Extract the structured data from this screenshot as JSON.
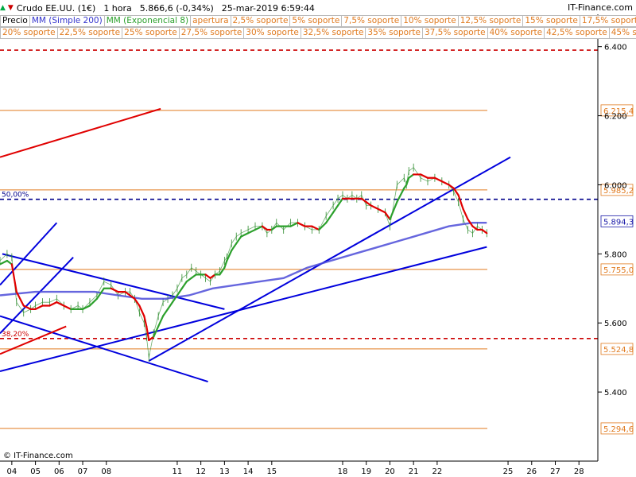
{
  "header": {
    "instrument": "Crudo EE.UU. (1€)",
    "timeframe": "1 hora",
    "quote": "5.866,6 (-0,34%)",
    "datetime": "25-mar-2019 6:59:44",
    "brand": "IT-Finance.com"
  },
  "legend": {
    "row1": [
      {
        "label": "Precio",
        "color": "#000000"
      },
      {
        "label": "MM (Simple 200)",
        "color": "#3333cc"
      },
      {
        "label": "MM (Exponencial 8)",
        "color": "#2ca02c"
      },
      {
        "label": "apertura",
        "color": "#e07a1f"
      },
      {
        "label": "2,5% soporte",
        "color": "#e07a1f"
      },
      {
        "label": "5% soporte",
        "color": "#e07a1f"
      },
      {
        "label": "7,5% soporte",
        "color": "#e07a1f"
      },
      {
        "label": "10% soporte",
        "color": "#e07a1f"
      },
      {
        "label": "12,5% soporte",
        "color": "#e07a1f"
      },
      {
        "label": "15% soporte",
        "color": "#e07a1f"
      },
      {
        "label": "17,5% soporte",
        "color": "#e07a1f"
      }
    ],
    "row2": [
      {
        "label": "20% soporte",
        "color": "#e07a1f"
      },
      {
        "label": "22,5% soporte",
        "color": "#e07a1f"
      },
      {
        "label": "25% soporte",
        "color": "#e07a1f"
      },
      {
        "label": "27,5% soporte",
        "color": "#e07a1f"
      },
      {
        "label": "30% soporte",
        "color": "#e07a1f"
      },
      {
        "label": "32,5% soporte",
        "color": "#e07a1f"
      },
      {
        "label": "35% soporte",
        "color": "#e07a1f"
      },
      {
        "label": "37,5% soporte",
        "color": "#e07a1f"
      },
      {
        "label": "40% soporte",
        "color": "#e07a1f"
      },
      {
        "label": "42,5% soporte",
        "color": "#e07a1f"
      },
      {
        "label": "45% s",
        "color": "#e07a1f"
      }
    ]
  },
  "footer": {
    "copyright": "© IT-Finance.com"
  },
  "chart_data": {
    "type": "line",
    "title": "Crudo EE.UU. (1€)",
    "x_unit": "day of March 2019",
    "xlim": [
      3.5,
      28.8
    ],
    "ylim": [
      5.2,
      6.42
    ],
    "x_ticks": [
      4,
      5,
      6,
      7,
      8,
      11,
      12,
      13,
      14,
      15,
      18,
      19,
      20,
      21,
      22,
      25,
      26,
      27,
      28
    ],
    "x_tick_labels": [
      "04",
      "05",
      "06",
      "07",
      "08",
      "11",
      "12",
      "13",
      "14",
      "15",
      "18",
      "19",
      "20",
      "21",
      "22",
      "25",
      "26",
      "27",
      "28"
    ],
    "y_ticks": [
      5.4,
      5.6,
      5.8,
      6.0,
      6.2,
      6.4
    ],
    "y_tick_labels": [
      "5.400",
      "5.600",
      "5.800",
      "6.000",
      "6.200",
      "6.400"
    ],
    "grid": false,
    "legend_placement": "top",
    "price_series": {
      "name": "Precio",
      "x": [
        3.5,
        3.8,
        4.0,
        4.2,
        4.5,
        4.8,
        5.0,
        5.3,
        5.6,
        5.9,
        6.2,
        6.5,
        6.8,
        7.0,
        7.3,
        7.6,
        7.9,
        8.2,
        8.5,
        8.8,
        9.0,
        9.2,
        9.4,
        9.6,
        9.7,
        9.8,
        10.0,
        10.2,
        10.4,
        10.6,
        10.8,
        11.0,
        11.2,
        11.4,
        11.6,
        11.8,
        12.0,
        12.2,
        12.4,
        12.6,
        12.8,
        13.0,
        13.1,
        13.3,
        13.5,
        13.7,
        14.0,
        14.3,
        14.6,
        14.8,
        15.0,
        15.2,
        15.5,
        15.8,
        16.1,
        16.4,
        16.7,
        17.0,
        17.3,
        17.6,
        17.8,
        18.0,
        18.2,
        18.4,
        18.6,
        18.8,
        19.0,
        19.2,
        19.5,
        19.8,
        20.0,
        20.3,
        20.6,
        20.7,
        20.8,
        21.0,
        21.3,
        21.6,
        21.9,
        22.2,
        22.5,
        22.7,
        22.9,
        23.1,
        23.3,
        23.5,
        23.7,
        23.9,
        24.1
      ],
      "y": [
        5.78,
        5.8,
        5.79,
        5.66,
        5.63,
        5.64,
        5.65,
        5.66,
        5.66,
        5.67,
        5.65,
        5.64,
        5.65,
        5.64,
        5.66,
        5.68,
        5.72,
        5.71,
        5.68,
        5.69,
        5.69,
        5.67,
        5.63,
        5.6,
        5.56,
        5.5,
        5.57,
        5.62,
        5.66,
        5.67,
        5.68,
        5.7,
        5.73,
        5.74,
        5.76,
        5.75,
        5.74,
        5.73,
        5.72,
        5.74,
        5.75,
        5.78,
        5.79,
        5.83,
        5.85,
        5.86,
        5.87,
        5.88,
        5.88,
        5.86,
        5.87,
        5.89,
        5.87,
        5.89,
        5.89,
        5.88,
        5.87,
        5.87,
        5.91,
        5.94,
        5.96,
        5.97,
        5.96,
        5.97,
        5.96,
        5.97,
        5.94,
        5.94,
        5.93,
        5.92,
        5.88,
        6.0,
        6.02,
        6.0,
        6.04,
        6.05,
        6.02,
        6.01,
        6.02,
        6.01,
        6.0,
        5.98,
        5.95,
        5.9,
        5.87,
        5.86,
        5.88,
        5.87,
        5.86
      ]
    },
    "ema8_series": {
      "name": "MM (Exponencial 8)",
      "x": [
        3.5,
        3.8,
        4.0,
        4.2,
        4.5,
        4.8,
        5.0,
        5.3,
        5.6,
        5.9,
        6.2,
        6.5,
        6.8,
        7.0,
        7.3,
        7.6,
        7.9,
        8.2,
        8.5,
        8.8,
        9.0,
        9.2,
        9.4,
        9.6,
        9.7,
        9.8,
        10.0,
        10.2,
        10.4,
        10.6,
        10.8,
        11.0,
        11.2,
        11.4,
        11.6,
        11.8,
        12.0,
        12.2,
        12.4,
        12.6,
        12.8,
        13.0,
        13.1,
        13.3,
        13.5,
        13.7,
        14.0,
        14.3,
        14.6,
        14.8,
        15.0,
        15.2,
        15.5,
        15.8,
        16.1,
        16.4,
        16.7,
        17.0,
        17.3,
        17.6,
        17.8,
        18.0,
        18.2,
        18.4,
        18.6,
        18.8,
        19.0,
        19.2,
        19.5,
        19.8,
        20.0,
        20.3,
        20.6,
        20.7,
        20.8,
        21.0,
        21.3,
        21.6,
        21.9,
        22.2,
        22.5,
        22.7,
        22.9,
        23.1,
        23.3,
        23.5,
        23.7,
        23.9,
        24.1
      ],
      "y": [
        5.77,
        5.78,
        5.77,
        5.69,
        5.65,
        5.64,
        5.64,
        5.65,
        5.65,
        5.66,
        5.65,
        5.64,
        5.64,
        5.64,
        5.65,
        5.67,
        5.7,
        5.7,
        5.69,
        5.69,
        5.68,
        5.67,
        5.65,
        5.62,
        5.59,
        5.55,
        5.56,
        5.59,
        5.62,
        5.64,
        5.66,
        5.68,
        5.7,
        5.72,
        5.73,
        5.74,
        5.74,
        5.74,
        5.73,
        5.74,
        5.74,
        5.76,
        5.78,
        5.81,
        5.83,
        5.85,
        5.86,
        5.87,
        5.88,
        5.87,
        5.87,
        5.88,
        5.88,
        5.88,
        5.89,
        5.88,
        5.88,
        5.87,
        5.89,
        5.92,
        5.94,
        5.96,
        5.96,
        5.96,
        5.96,
        5.96,
        5.95,
        5.94,
        5.93,
        5.92,
        5.9,
        5.95,
        5.99,
        6.0,
        6.02,
        6.03,
        6.03,
        6.02,
        6.02,
        6.01,
        6.0,
        5.99,
        5.97,
        5.93,
        5.9,
        5.88,
        5.87,
        5.87,
        5.86
      ],
      "rising_color": "#2ca02c",
      "falling_color": "#e00000",
      "color_segments": [
        {
          "from": 3.5,
          "to": 4.0,
          "trend": "up"
        },
        {
          "from": 4.0,
          "to": 6.5,
          "trend": "down"
        },
        {
          "from": 6.5,
          "to": 8.2,
          "trend": "up"
        },
        {
          "from": 8.2,
          "to": 10.0,
          "trend": "down"
        },
        {
          "from": 10.0,
          "to": 12.2,
          "trend": "up"
        },
        {
          "from": 12.2,
          "to": 12.6,
          "trend": "down"
        },
        {
          "from": 12.6,
          "to": 14.6,
          "trend": "up"
        },
        {
          "from": 14.6,
          "to": 15.0,
          "trend": "down"
        },
        {
          "from": 15.0,
          "to": 16.2,
          "trend": "up"
        },
        {
          "from": 16.2,
          "to": 16.9,
          "trend": "down"
        },
        {
          "from": 16.9,
          "to": 18.0,
          "trend": "up"
        },
        {
          "from": 18.0,
          "to": 20.0,
          "trend": "down"
        },
        {
          "from": 20.0,
          "to": 21.0,
          "trend": "up"
        },
        {
          "from": 21.0,
          "to": 24.1,
          "trend": "down"
        }
      ]
    },
    "sma200_series": {
      "name": "MM (Simple 200)",
      "color": "#4b4bd8",
      "x": [
        3.5,
        5.0,
        6.5,
        7.5,
        8.5,
        9.5,
        10.5,
        11.5,
        12.5,
        13.5,
        14.5,
        15.5,
        16.5,
        17.5,
        18.5,
        19.5,
        20.5,
        21.5,
        22.5,
        23.5,
        24.1
      ],
      "y": [
        5.68,
        5.69,
        5.69,
        5.69,
        5.68,
        5.67,
        5.67,
        5.68,
        5.7,
        5.71,
        5.72,
        5.73,
        5.76,
        5.78,
        5.8,
        5.82,
        5.84,
        5.86,
        5.88,
        5.89,
        5.89
      ]
    },
    "horizontal_levels": [
      {
        "value": 6.2154,
        "label": "6.215,4",
        "color": "#e07a1f",
        "style": "solid",
        "text_color": "#e07a1f"
      },
      {
        "value": 5.9852,
        "label": "5.985,2",
        "color": "#e07a1f",
        "style": "solid",
        "text_color": "#e07a1f"
      },
      {
        "value": 5.8943,
        "label": "5.894,3",
        "color": "#4b4bd8",
        "style": "none",
        "text_color": "#1a1aa8"
      },
      {
        "value": 5.755,
        "label": "5.755,0",
        "color": "#e07a1f",
        "style": "solid",
        "text_color": "#e07a1f"
      },
      {
        "value": 5.5248,
        "label": "5.524,8",
        "color": "#e07a1f",
        "style": "solid",
        "text_color": "#e07a1f"
      },
      {
        "value": 5.2946,
        "label": "5.294,6",
        "color": "#e07a1f",
        "style": "solid",
        "text_color": "#e07a1f"
      }
    ],
    "fibonacci_levels": [
      {
        "value": 5.958,
        "label": "50,00%",
        "color": "#00008b",
        "style": "dashed"
      },
      {
        "value": 5.555,
        "label": "38,20%",
        "color": "#cc0000",
        "style": "dashed"
      },
      {
        "value": 6.39,
        "label": "",
        "color": "#cc0000",
        "style": "dashed"
      }
    ],
    "trendlines": [
      {
        "color": "#0000dd",
        "x1": 3.5,
        "y1": 5.71,
        "x2": 5.9,
        "y2": 5.89
      },
      {
        "color": "#0000dd",
        "x1": 3.5,
        "y1": 5.57,
        "x2": 6.6,
        "y2": 5.79
      },
      {
        "color": "#0000dd",
        "x1": 3.6,
        "y1": 5.8,
        "x2": 13.0,
        "y2": 5.64
      },
      {
        "color": "#0000dd",
        "x1": 3.5,
        "y1": 5.46,
        "x2": 24.1,
        "y2": 5.82
      },
      {
        "color": "#0000dd",
        "x1": 9.8,
        "y1": 5.49,
        "x2": 25.1,
        "y2": 6.08
      },
      {
        "color": "#0000dd",
        "x1": 3.5,
        "y1": 5.62,
        "x2": 12.3,
        "y2": 5.43
      },
      {
        "color": "#e00000",
        "x1": 3.5,
        "y1": 6.08,
        "x2": 10.3,
        "y2": 6.22
      },
      {
        "color": "#e00000",
        "x1": 3.5,
        "y1": 5.51,
        "x2": 6.3,
        "y2": 5.59
      }
    ]
  }
}
